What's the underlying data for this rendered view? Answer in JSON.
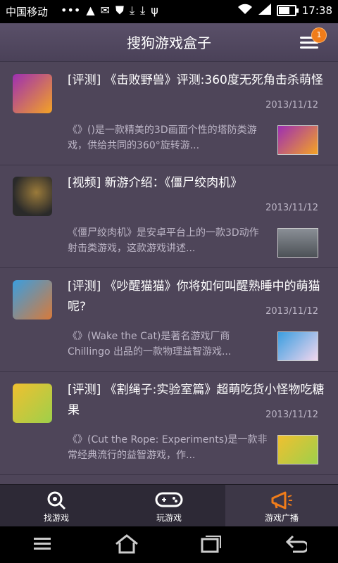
{
  "status": {
    "carrier": "中国移动",
    "time": "17:38",
    "battery_level": 0.75
  },
  "header": {
    "title": "搜狗游戏盒子",
    "badge": "1"
  },
  "items": [
    {
      "title": "[评测] 《击败野兽》评测:360度无死角击杀萌怪",
      "date": "2013/11/12",
      "summary": "《》()是一款精美的3D画面个性的塔防类游戏，供给共同的360°旋转游...",
      "thumb_colors": [
        "#9d2eb3",
        "#f4a324"
      ]
    },
    {
      "title": "[视频] 新游介绍：《僵尸绞肉机》",
      "date": "2013/11/12",
      "summary": "《僵尸绞肉机》是安卓平台上的一款3D动作射击类游戏，这款游戏讲述...",
      "thumb_colors": [
        "#2a2a2a",
        "#9a7a3a"
      ]
    },
    {
      "title": "[评测] 《吵醒猫猫》你将如何叫醒熟睡中的萌猫呢?",
      "date": "2013/11/12",
      "summary": "《》(Wake the Cat)是著名游戏厂商Chillingo 出品的一款物理益智游戏...",
      "thumb_colors": [
        "#3a9ee0",
        "#d87a3a"
      ]
    },
    {
      "title": "[评测] 《割绳子:实验室篇》超萌吃货小怪物吃糖果",
      "date": "2013/11/12",
      "summary": "《》(Cut the Rope: Experiments)是一款非常经典流行的益智游戏，作...",
      "thumb_colors": [
        "#9ed04a",
        "#f0c030"
      ]
    }
  ],
  "tabs": [
    {
      "label": "找游戏",
      "icon": "search-game-icon",
      "active": false
    },
    {
      "label": "玩游戏",
      "icon": "gamepad-icon",
      "active": false
    },
    {
      "label": "游戏广播",
      "icon": "megaphone-icon",
      "active": true
    }
  ],
  "colors": {
    "accent": "#f07c1a",
    "list_bg": "#4e4559",
    "header_bg": "#514860"
  }
}
